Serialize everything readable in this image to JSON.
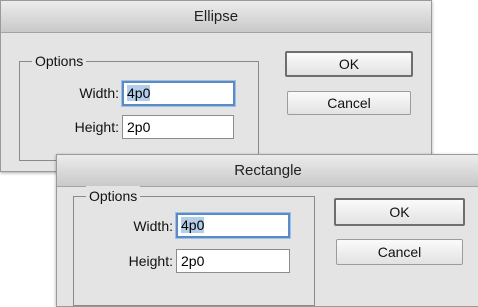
{
  "ellipse_dialog": {
    "title": "Ellipse",
    "options_legend": "Options",
    "width_label": "Width:",
    "width_value": "4p0",
    "height_label": "Height:",
    "height_value": "2p0",
    "ok_label": "OK",
    "cancel_label": "Cancel"
  },
  "rectangle_dialog": {
    "title": "Rectangle",
    "options_legend": "Options",
    "width_label": "Width:",
    "width_value": "4p0",
    "height_label": "Height:",
    "height_value": "2p0",
    "ok_label": "OK",
    "cancel_label": "Cancel"
  },
  "colors": {
    "focus_ring": "#5b8bc4",
    "selection": "#b4cde8",
    "dialog_bg": "#e4e4e4"
  }
}
